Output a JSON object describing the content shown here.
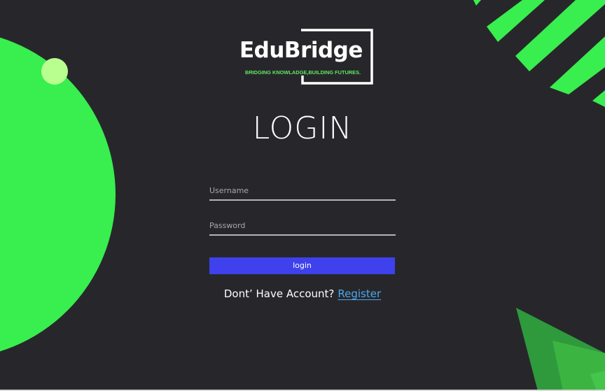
{
  "brand": {
    "name": "EduBridge",
    "tagline": "BRIDGING KNOWLADGE,BUILDING FUTURES."
  },
  "page": {
    "title": "LOGIN"
  },
  "form": {
    "username_placeholder": "Username",
    "password_placeholder": "Password",
    "submit_label": "login"
  },
  "register": {
    "prompt": "Dont’ Have Account?",
    "link_label": "Register"
  },
  "colors": {
    "background": "#27272b",
    "accent_green": "#39ee4f",
    "button_blue": "#3e41ec",
    "link_blue": "#4aa8ee"
  }
}
